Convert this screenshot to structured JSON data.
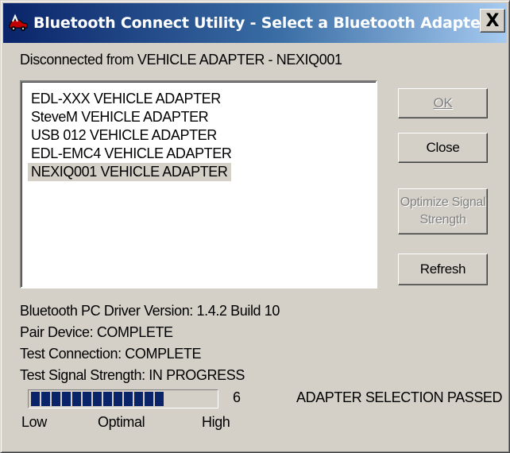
{
  "window": {
    "title": "Bluetooth Connect Utility - Select a Bluetooth Adapter",
    "close_glyph": "X"
  },
  "status": {
    "message": "Disconnected from VEHICLE ADAPTER - NEXIQ001"
  },
  "adapters": [
    {
      "label": "EDL-XXX VEHICLE ADAPTER",
      "selected": false
    },
    {
      "label": "SteveM VEHICLE ADAPTER",
      "selected": false
    },
    {
      "label": "USB 012 VEHICLE ADAPTER",
      "selected": false
    },
    {
      "label": "EDL-EMC4 VEHICLE ADAPTER",
      "selected": false
    },
    {
      "label": "NEXIQ001 VEHICLE ADAPTER",
      "selected": true
    }
  ],
  "buttons": {
    "ok": {
      "label": "OK",
      "enabled": false
    },
    "close": {
      "label": "Close",
      "enabled": true
    },
    "optimize": {
      "label_line1": "Optimize Signal",
      "label_line2": "Strength",
      "enabled": false
    },
    "refresh": {
      "label": "Refresh",
      "enabled": true
    }
  },
  "info": {
    "driver_version": "Bluetooth PC Driver Version: 1.4.2 Build 10",
    "pair_device": "Pair Device: COMPLETE",
    "test_connection": "Test Connection: COMPLETE",
    "test_signal": "Test Signal Strength: IN PROGRESS"
  },
  "signal": {
    "value": "6",
    "filled_segments": 13,
    "total_segments": 18,
    "low_label": "Low",
    "optimal_label": "Optimal",
    "high_label": "High",
    "result": "ADAPTER SELECTION PASSED",
    "fill_color": "#0a246a"
  },
  "icons": {
    "app": "bluetooth-car-icon"
  }
}
